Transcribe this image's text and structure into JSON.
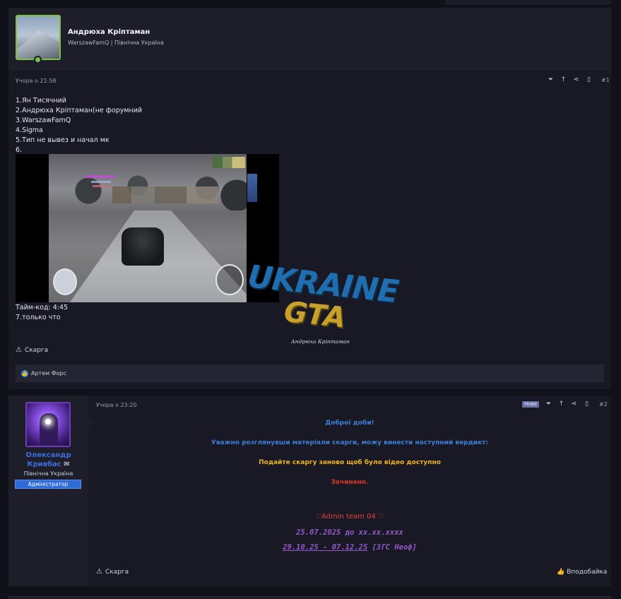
{
  "post1": {
    "author": "Андрюха Кріптаман",
    "subtitle": "WarszawFamQ | Північна Україна",
    "time": "Учора о 21:58",
    "number": "#1",
    "body_lines": [
      "1.Ян Тисячний",
      "2.Андрюха Кріптаман(не форумний",
      "3.WarszawFamQ",
      "4.Sigma",
      "5.Тип не вывез и начал мк",
      "6."
    ],
    "after_video_lines": [
      "Тайм-код: 4:45",
      "7.только что"
    ],
    "watermark": {
      "line1": "UKRAINE",
      "line2": "GTA",
      "signature": "Андрюха Кріптаман"
    },
    "report_label": "Скарга",
    "reaction_user": "Артем Форс"
  },
  "post2": {
    "author_line1": "Олександр",
    "author_line2": "Кривбас",
    "region": "Північна Україна",
    "role": "Адміністратор",
    "time": "Учора о 23:20",
    "new_badge": "Нове",
    "number": "#2",
    "greeting": "Доброї доби!",
    "verdict_intro": "Уважно розглянувши матеріали скарги, можу винести наступний вердикт:",
    "resubmit": "Подайте скаргу заново щоб було відео доступно",
    "closed": "Зачинено.",
    "team": "♡Admin team 04 ♡",
    "date_range1": "25.07.2025 до xx.xx.xxxx",
    "date_range2_link": "29.10.25 - 07.12.25",
    "date_range2_tail": " [ЗГС Неоф]",
    "report_label": "Скарга",
    "like_label": "Вподобайка"
  },
  "colors": {
    "page_bg": "#101119",
    "card_bg": "#181924",
    "accent_blue": "#3d7fd6",
    "warning_yellow": "#f0b31c",
    "closed_red": "#d8372b",
    "date_purple": "#9158c9",
    "online_green": "#7dc243"
  }
}
